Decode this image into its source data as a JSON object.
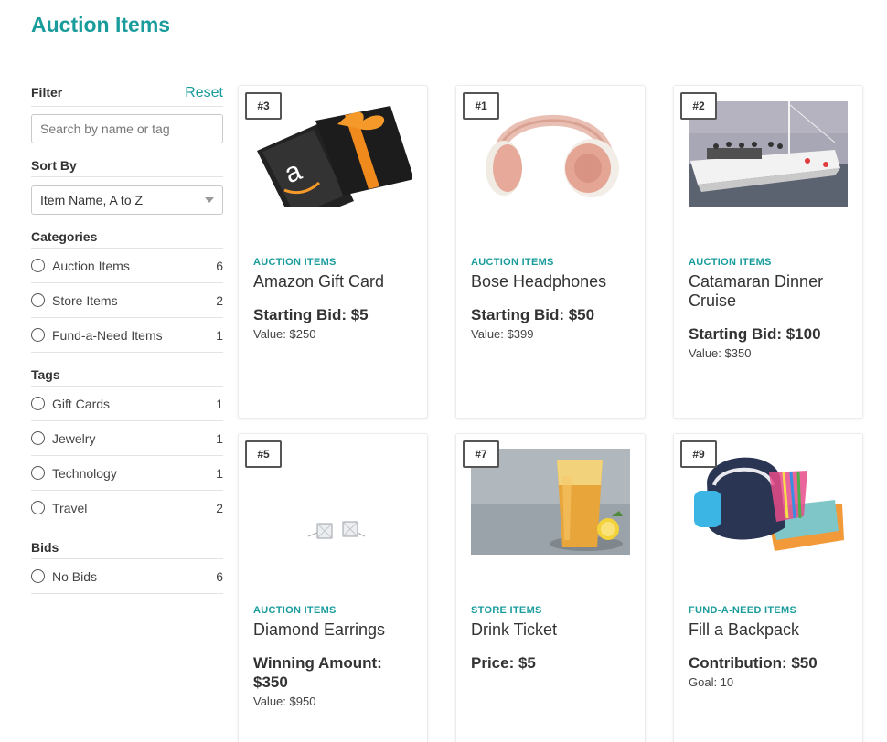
{
  "page": {
    "title": "Auction Items"
  },
  "sidebar": {
    "filter_label": "Filter",
    "reset_label": "Reset",
    "search_placeholder": "Search by name or tag",
    "sort_label": "Sort By",
    "sort_value": "Item Name, A to Z",
    "categories_label": "Categories",
    "categories": [
      {
        "label": "Auction Items",
        "count": "6"
      },
      {
        "label": "Store Items",
        "count": "2"
      },
      {
        "label": "Fund-a-Need Items",
        "count": "1"
      }
    ],
    "tags_label": "Tags",
    "tags": [
      {
        "label": "Gift Cards",
        "count": "1"
      },
      {
        "label": "Jewelry",
        "count": "1"
      },
      {
        "label": "Technology",
        "count": "1"
      },
      {
        "label": "Travel",
        "count": "2"
      }
    ],
    "bids_label": "Bids",
    "bids": [
      {
        "label": "No Bids",
        "count": "6"
      }
    ]
  },
  "items": [
    {
      "number": "#3",
      "category": "AUCTION ITEMS",
      "name": "Amazon Gift Card",
      "price_line": "Starting Bid: $5",
      "sub_line": "Value: $250",
      "image_icon": "amazon-gift-card-icon"
    },
    {
      "number": "#1",
      "category": "AUCTION ITEMS",
      "name": "Bose Headphones",
      "price_line": "Starting Bid: $50",
      "sub_line": "Value: $399",
      "image_icon": "headphones-icon"
    },
    {
      "number": "#2",
      "category": "AUCTION ITEMS",
      "name": "Catamaran Dinner Cruise",
      "price_line": "Starting Bid: $100",
      "sub_line": "Value: $350",
      "image_icon": "catamaran-photo"
    },
    {
      "number": "#5",
      "category": "AUCTION ITEMS",
      "name": "Diamond Earrings",
      "price_line": "Winning Amount: $350",
      "sub_line": "Value: $950",
      "image_icon": "earrings-icon"
    },
    {
      "number": "#7",
      "category": "STORE ITEMS",
      "name": "Drink Ticket",
      "price_line": "Price: $5",
      "sub_line": "",
      "image_icon": "drink-photo"
    },
    {
      "number": "#9",
      "category": "FUND-A-NEED ITEMS",
      "name": "Fill a Backpack",
      "price_line": "Contribution: $50",
      "sub_line": "Goal: 10",
      "image_icon": "backpack-icon"
    }
  ],
  "colors": {
    "accent": "#1a9c9c",
    "text": "#333333",
    "border": "#e3e3e3"
  }
}
